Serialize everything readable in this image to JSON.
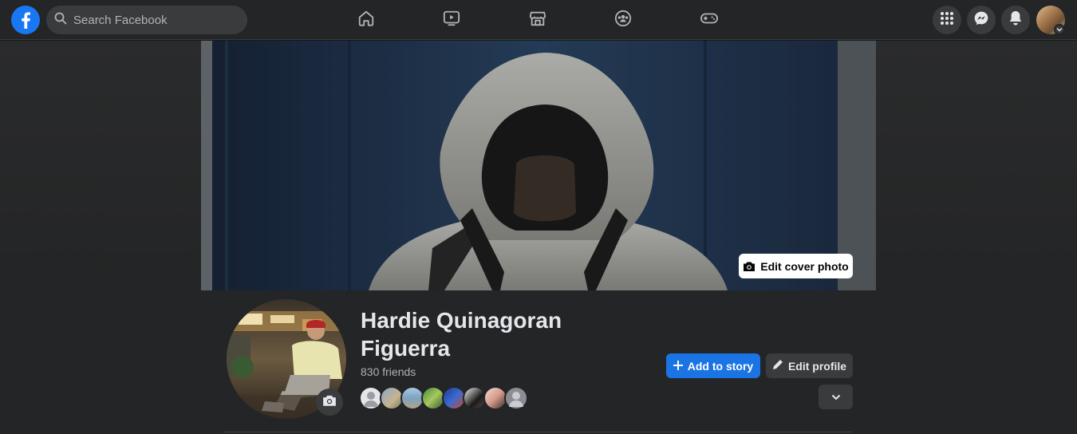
{
  "topbar": {
    "search_placeholder": "Search Facebook",
    "nav_icons": [
      "home-icon",
      "watch-icon",
      "marketplace-icon",
      "groups-icon",
      "gaming-icon"
    ],
    "right_icons": [
      "menu-grid-icon",
      "messenger-icon",
      "notifications-icon"
    ]
  },
  "cover": {
    "edit_label": "Edit cover photo"
  },
  "profile": {
    "name_line1": "Hardie Quinagoran",
    "name_line2": "Figuerra",
    "friends_count": "830 friends"
  },
  "actions": {
    "add_story_label": "Add to story",
    "edit_profile_label": "Edit profile"
  },
  "colors": {
    "accent": "#1b74e4",
    "brand": "#1877f2",
    "bg": "#18191a",
    "surface": "#242526",
    "button_secondary": "#3a3b3c"
  }
}
